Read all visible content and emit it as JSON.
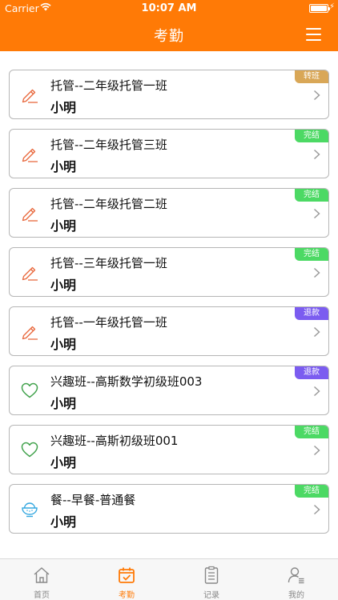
{
  "status_bar": {
    "carrier": "Carrier",
    "time": "10:07 AM"
  },
  "nav": {
    "title": "考勤"
  },
  "colors": {
    "brand": "#ff7a06",
    "transfer": "#d9a757",
    "completed": "#4cd964",
    "refund": "#7b5cf0"
  },
  "records": [
    {
      "course": "托管--二年级托管一班",
      "student": "小明",
      "status": "转班",
      "status_color": "#d9a757",
      "icon": "pencil-icon"
    },
    {
      "course": "托管--二年级托管三班",
      "student": "小明",
      "status": "完结",
      "status_color": "#4cd964",
      "icon": "pencil-icon"
    },
    {
      "course": "托管--二年级托管二班",
      "student": "小明",
      "status": "完结",
      "status_color": "#4cd964",
      "icon": "pencil-icon"
    },
    {
      "course": "托管--三年级托管一班",
      "student": "小明",
      "status": "完结",
      "status_color": "#4cd964",
      "icon": "pencil-icon"
    },
    {
      "course": "托管--一年级托管一班",
      "student": "小明",
      "status": "退款",
      "status_color": "#7b5cf0",
      "icon": "pencil-icon"
    },
    {
      "course": "兴趣班--高斯数学初级班003",
      "student": "小明",
      "status": "退款",
      "status_color": "#7b5cf0",
      "icon": "heart-icon"
    },
    {
      "course": "兴趣班--高斯初级班001",
      "student": "小明",
      "status": "完结",
      "status_color": "#4cd964",
      "icon": "heart-icon"
    },
    {
      "course": "餐--早餐-普通餐",
      "student": "小明",
      "status": "完结",
      "status_color": "#4cd964",
      "icon": "bowl-icon"
    }
  ],
  "tabbar": {
    "items": [
      {
        "label": "首页",
        "icon": "home-icon",
        "active": false
      },
      {
        "label": "考勤",
        "icon": "calendar-check-icon",
        "active": true
      },
      {
        "label": "记录",
        "icon": "clipboard-icon",
        "active": false
      },
      {
        "label": "我的",
        "icon": "user-icon",
        "active": false
      }
    ]
  }
}
